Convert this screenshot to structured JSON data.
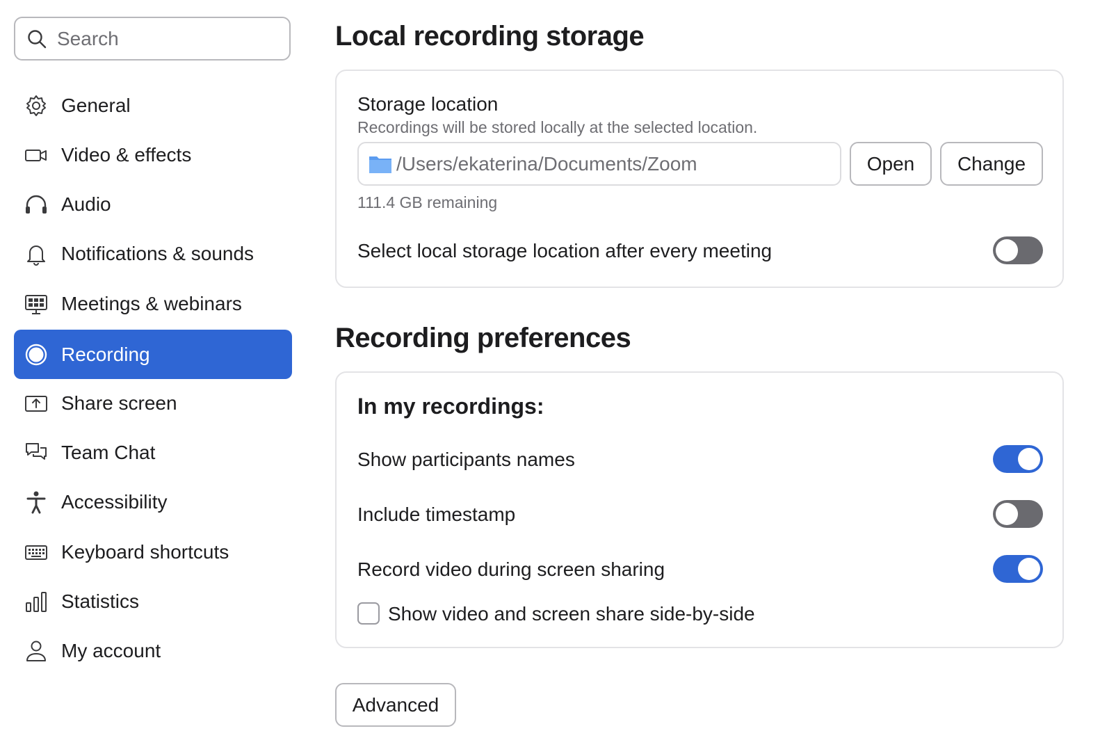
{
  "sidebar": {
    "search": {
      "placeholder": "Search"
    },
    "items": [
      {
        "label": "General",
        "icon": "gear-icon"
      },
      {
        "label": "Video & effects",
        "icon": "video-camera-icon"
      },
      {
        "label": "Audio",
        "icon": "headphones-icon"
      },
      {
        "label": "Notifications & sounds",
        "icon": "bell-icon"
      },
      {
        "label": "Meetings & webinars",
        "icon": "meeting-screen-icon"
      },
      {
        "label": "Recording",
        "icon": "record-icon",
        "active": true
      },
      {
        "label": "Share screen",
        "icon": "share-screen-icon"
      },
      {
        "label": "Team Chat",
        "icon": "chat-bubbles-icon"
      },
      {
        "label": "Accessibility",
        "icon": "accessibility-icon"
      },
      {
        "label": "Keyboard shortcuts",
        "icon": "keyboard-icon"
      },
      {
        "label": "Statistics",
        "icon": "bar-chart-icon"
      },
      {
        "label": "My account",
        "icon": "person-icon"
      }
    ],
    "active_color": "#2f66d4"
  },
  "local_storage": {
    "title": "Local recording storage",
    "storage_location_label": "Storage location",
    "storage_location_desc": "Recordings will be stored locally at the selected location.",
    "path": "/Users/ekaterina/Documents/Zoom",
    "open_label": "Open",
    "change_label": "Change",
    "remaining": "111.4 GB remaining",
    "select_after_meeting_label": "Select local storage location after every meeting",
    "select_after_meeting_on": false
  },
  "recording_preferences": {
    "title": "Recording preferences",
    "subtitle": "In my recordings:",
    "options": [
      {
        "label": "Show participants names",
        "on": true
      },
      {
        "label": "Include timestamp",
        "on": false
      },
      {
        "label": "Record video during screen sharing",
        "on": true
      }
    ],
    "side_by_side_label": "Show video and screen share side-by-side",
    "side_by_side_checked": false,
    "advanced_label": "Advanced"
  },
  "colors": {
    "accent": "#2f66d4",
    "toggle_off": "#6a6a6f",
    "border": "#e3e3e6"
  }
}
